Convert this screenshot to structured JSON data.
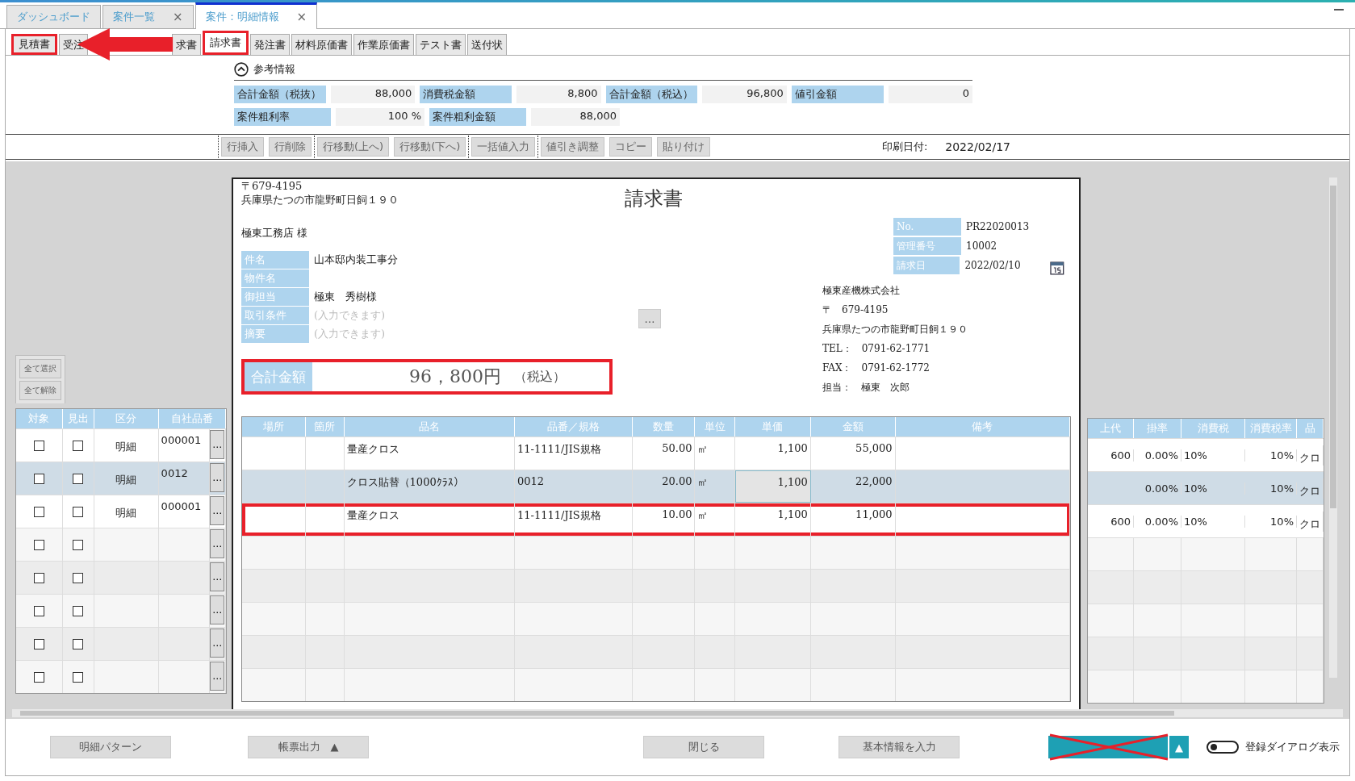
{
  "window_tabs": [
    {
      "label": "ダッシュボード",
      "closable": false,
      "selected": false
    },
    {
      "label": "案件一覧",
      "closable": true,
      "selected": false
    },
    {
      "label": "案件：明細情報",
      "closable": true,
      "selected": true
    }
  ],
  "close_mark": "×",
  "doc_tabs": [
    {
      "label": "見積書",
      "selected": false,
      "highlighted": true
    },
    {
      "label": "受注",
      "selected": false,
      "highlighted": false
    },
    {
      "label": "求書",
      "selected": false,
      "highlighted": false
    },
    {
      "label": "請求書",
      "selected": true,
      "highlighted": true
    },
    {
      "label": "発注書",
      "selected": false,
      "highlighted": false
    },
    {
      "label": "材料原価書",
      "selected": false,
      "highlighted": false
    },
    {
      "label": "作業原価書",
      "selected": false,
      "highlighted": false
    },
    {
      "label": "テスト書",
      "selected": false,
      "highlighted": false
    },
    {
      "label": "送付状",
      "selected": false,
      "highlighted": false
    }
  ],
  "reference": {
    "title": "参考情報",
    "expanded": true,
    "rows": [
      [
        {
          "label": "合計金額（税抜）",
          "value": "88,000"
        },
        {
          "label": "消費税金額",
          "value": "8,800"
        },
        {
          "label": "合計金額（税込）",
          "value": "96,800"
        },
        {
          "label": "値引金額",
          "value": "0"
        }
      ],
      [
        {
          "label": "案件粗利率",
          "value": "100 %"
        },
        {
          "label": "案件粗利金額",
          "value": "88,000"
        }
      ]
    ]
  },
  "toolbar": {
    "groups": [
      [
        "行挿入",
        "行削除"
      ],
      [
        "行移動(上へ)",
        "行移動(下へ)"
      ],
      [
        "一括値入力"
      ],
      [
        "値引き調整",
        "コピー",
        "貼り付け"
      ]
    ],
    "print_date_label": "印刷日付:",
    "print_date": "2022/02/17"
  },
  "select_all": "全て選択",
  "deselect_all": "全て解除",
  "left_columns": [
    "対象",
    "見出",
    "区分",
    "自社品番"
  ],
  "left_rows": [
    {
      "target_checked": false,
      "heading_checked": false,
      "type": "明細",
      "code": "000001",
      "button": "…"
    },
    {
      "target_checked": false,
      "heading_checked": false,
      "type": "明細",
      "code": "0012",
      "button": "…"
    },
    {
      "target_checked": false,
      "heading_checked": false,
      "type": "明細",
      "code": "000001",
      "button": "…"
    },
    {
      "target_checked": false,
      "heading_checked": false,
      "button": "…"
    },
    {
      "target_checked": false,
      "heading_checked": false,
      "button": "…"
    },
    {
      "target_checked": false,
      "heading_checked": false,
      "button": "…"
    },
    {
      "target_checked": false,
      "heading_checked": false,
      "button": "…"
    },
    {
      "target_checked": false,
      "heading_checked": false,
      "button": "…"
    }
  ],
  "document": {
    "postal": "〒679-4195",
    "address": "兵庫県たつの市龍野町日飼１９０",
    "title": "請求書",
    "customer": "極東工務店 様",
    "fields": [
      {
        "label": "件名",
        "value": "山本邸内装工事分"
      },
      {
        "label": "物件名"
      },
      {
        "label": "御担当",
        "value": "極東　秀樹様"
      },
      {
        "label": "取引条件",
        "placeholder": "(入力できます)"
      },
      {
        "label": "摘要",
        "placeholder": "(入力できます)"
      }
    ],
    "more_button": "…",
    "info": [
      {
        "label": "No.",
        "value": "PR22020013"
      },
      {
        "label": "管理番号",
        "value": "10002"
      },
      {
        "label": "請求日",
        "value": "2022/02/10"
      }
    ],
    "company": [
      "極東産機株式会社",
      "〒　679-4195",
      "兵庫県たつの市龍野町日飼１９０",
      "TEL：　0791-62-1771",
      "FAX：　0791-62-1772",
      "担当：　極東　次郎"
    ],
    "total_label": "合計金額",
    "total_amount": "96，800円",
    "total_note": "（税込）",
    "columns": [
      "場所",
      "箇所",
      "品名",
      "品番／規格",
      "数量",
      "単位",
      "単価",
      "金額",
      "備考"
    ],
    "rows": [
      {
        "selected": false,
        "highlighted": false,
        "name": "量産クロス",
        "spec": "11-1111/JIS規格",
        "qty": "50.00",
        "unit": "㎡",
        "unit_price": {
          "value": "1,100",
          "focused": false
        },
        "amount": "55,000"
      },
      {
        "selected": true,
        "highlighted": false,
        "name": "クロス貼替（1000ｸﾗｽ）",
        "spec": "0012",
        "qty": "20.00",
        "unit": "㎡",
        "unit_price": {
          "value": "1,100",
          "focused": true
        },
        "amount": "22,000"
      },
      {
        "selected": false,
        "highlighted": true,
        "name": "量産クロス",
        "spec": "11-1111/JIS規格",
        "qty": "10.00",
        "unit": "㎡",
        "unit_price": {
          "value": "1,100",
          "focused": false
        },
        "amount": "11,000"
      }
    ]
  },
  "right_columns": [
    "上代",
    "掛率",
    "消費税",
    "消費税率",
    "品"
  ],
  "right_rows": [
    {
      "list_price": "600",
      "rate": "0.00%",
      "tax": "10%",
      "tax_rate": "10%",
      "item": "クロ"
    },
    {
      "rate": "0.00%",
      "tax": "10%",
      "tax_rate": "10%",
      "item": "クロ"
    },
    {
      "list_price": "600",
      "rate": "0.00%",
      "tax": "10%",
      "tax_rate": "10%",
      "item": "クロ"
    }
  ],
  "footer": {
    "pattern_button": "明細パターン",
    "output_button": "帳票出力",
    "output_caret": "▲",
    "close_button": "閉じる",
    "basic_info_button": "基本情報を入力",
    "register_caret": "▲",
    "dialog_toggle": {
      "on": false,
      "label": "登録ダイアログ表示"
    }
  }
}
